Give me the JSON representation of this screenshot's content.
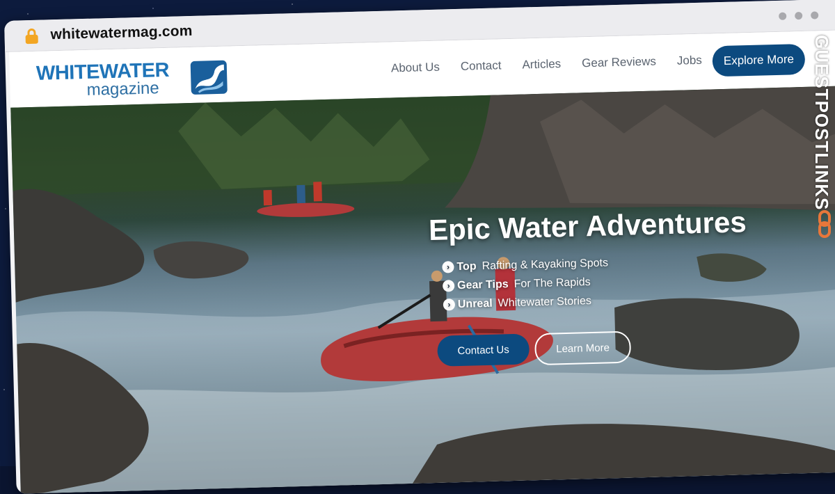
{
  "browser": {
    "url": "whitewatermag.com",
    "lock_icon": "lock-icon"
  },
  "logo": {
    "line1": "WHITEWATER",
    "line2": "magazine"
  },
  "nav": {
    "items": [
      "About Us",
      "Contact",
      "Articles",
      "Gear Reviews",
      "Jobs"
    ],
    "cta": "Explore More"
  },
  "hero": {
    "headline": "Epic Water Adventures",
    "bullets": [
      {
        "bold": "Top",
        "text": "Rafting & Kayaking Spots"
      },
      {
        "bold": "Gear Tips",
        "text": "For The Rapids"
      },
      {
        "bold": "Unreal",
        "text": "Whitewater Stories"
      }
    ],
    "primary_button": "Contact Us",
    "secondary_button": "Learn More"
  },
  "watermark": {
    "text": "GUESTPOSTLINKS"
  },
  "colors": {
    "brand_blue": "#0c4a7f",
    "logo_blue": "#1f74b8",
    "lock": "#f3a623",
    "raft_red": "#b23a3a"
  }
}
